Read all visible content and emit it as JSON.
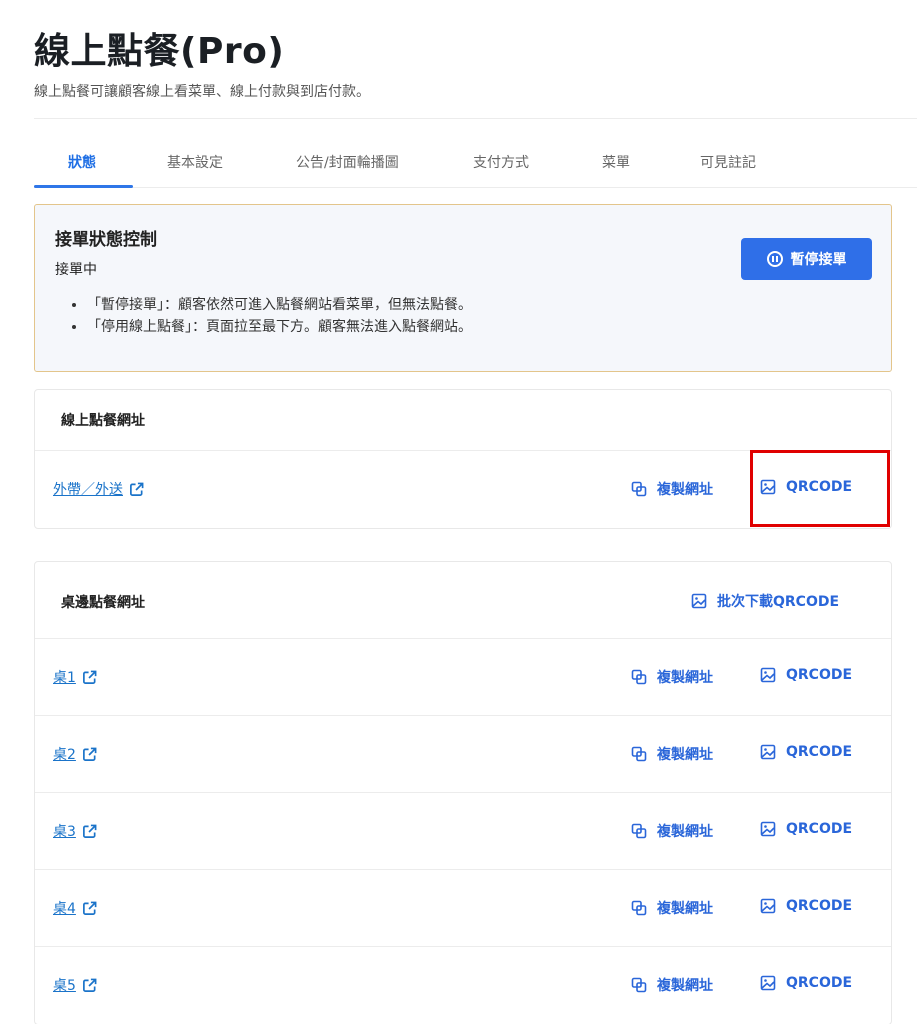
{
  "page": {
    "title": "線上點餐(Pro)",
    "subtitle": "線上點餐可讓顧客線上看菜單、線上付款與到店付款。"
  },
  "tabs": [
    {
      "label": "狀態",
      "active": true
    },
    {
      "label": "基本設定",
      "active": false
    },
    {
      "label": "公告/封面輪播圖",
      "active": false
    },
    {
      "label": "支付方式",
      "active": false
    },
    {
      "label": "菜單",
      "active": false
    },
    {
      "label": "可見註記",
      "active": false
    }
  ],
  "status_card": {
    "heading": "接單狀態控制",
    "state": "接單中",
    "notes": [
      "「暫停接單」：顧客依然可進入點餐網站看菜單，但無法點餐。",
      "「停用線上點餐」：頁面拉至最下方。顧客無法進入點餐網站。"
    ],
    "pause_button": "暫停接單"
  },
  "online_panel": {
    "title": "線上點餐網址",
    "row": {
      "label": "外帶／外送",
      "copy": "複製網址",
      "qrcode": "QRCODE"
    }
  },
  "table_panel": {
    "title": "桌邊點餐網址",
    "batch_download": "批次下載QRCODE",
    "rows": [
      {
        "label": "桌1",
        "copy": "複製網址",
        "qrcode": "QRCODE"
      },
      {
        "label": "桌2",
        "copy": "複製網址",
        "qrcode": "QRCODE"
      },
      {
        "label": "桌3",
        "copy": "複製網址",
        "qrcode": "QRCODE"
      },
      {
        "label": "桌4",
        "copy": "複製網址",
        "qrcode": "QRCODE"
      },
      {
        "label": "桌5",
        "copy": "複製網址",
        "qrcode": "QRCODE"
      }
    ]
  },
  "colors": {
    "accent": "#2f6fe8",
    "link": "#1a73c9",
    "highlight": "#e00000",
    "card_border": "#e3c58b"
  },
  "icons": {
    "copy": "copy-icon",
    "qrcode": "image-icon",
    "external": "external-link-icon",
    "pause": "pause-circle-icon"
  }
}
